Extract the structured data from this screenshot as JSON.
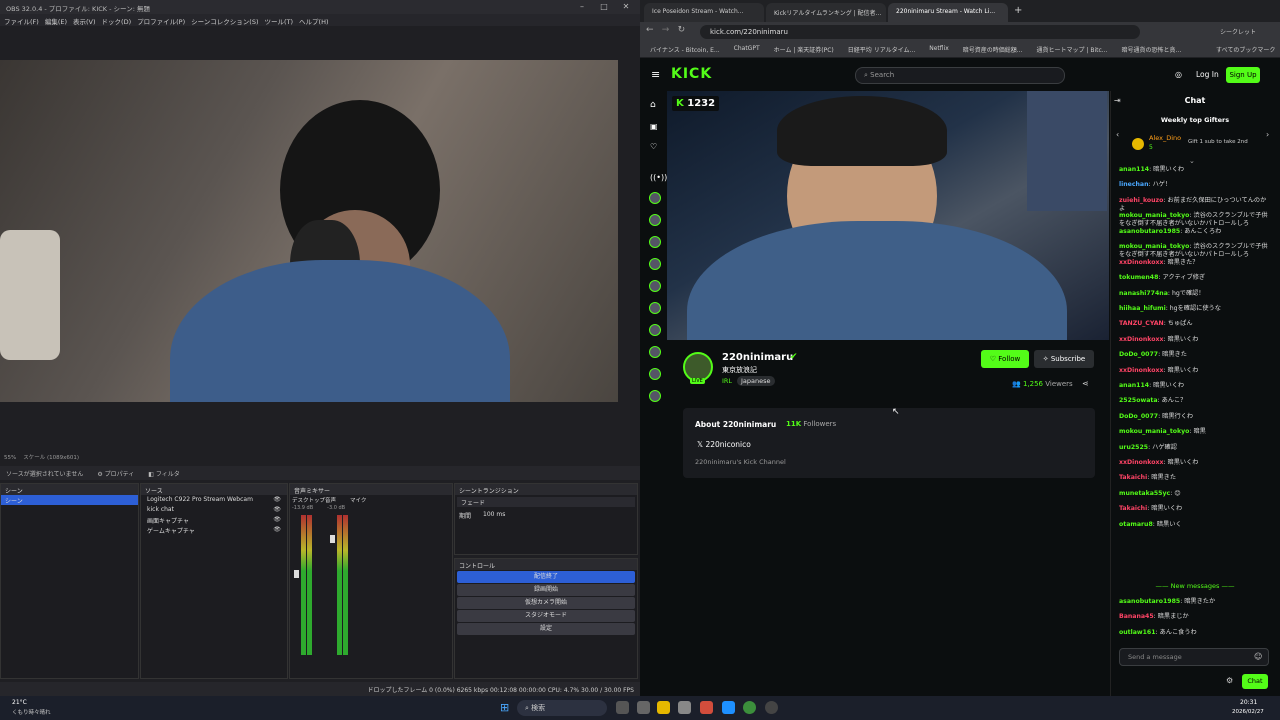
{
  "obs": {
    "title": "OBS 32.0.4 - プロファイル: KICK - シーン: 無題",
    "menu": [
      "ファイル(F)",
      "編集(E)",
      "表示(V)",
      "ドック(D)",
      "プロファイル(P)",
      "シーンコレクション(S)",
      "ツール(T)",
      "ヘルプ(H)"
    ],
    "zoom": "55%",
    "scale": "スケール (1089x601)",
    "no_source": "ソースが選択されていません",
    "properties": "プロパティ",
    "filters": "フィルタ",
    "scenes_header": "シーン",
    "scene_item": "シーン",
    "sources_header": "ソース",
    "sources": [
      "Logitech C922 Pro Stream Webcam",
      "kick chat",
      "画面キャプチャ",
      "ゲームキャプチャ"
    ],
    "mixer_header": "音声ミキサー",
    "mixer_ch1": "デスクトップ音声",
    "mixer_ch1_db": "-13.9 dB",
    "mixer_ch2": "マイク",
    "mixer_ch2_db": "-3.0 dB",
    "transition_header": "シーントランジション",
    "transition_value": "フェード",
    "duration_label": "期間",
    "duration_value": "100 ms",
    "controls_header": "コントロール",
    "controls": [
      "配信終了",
      "録画開始",
      "仮想カメラ開始",
      "スタジオモード",
      "設定"
    ],
    "status": "ドロップしたフレーム 0 (0.0%)   6265 kbps   00:12:08   00:00:00   CPU: 4.7%  30.00 / 30.00 FPS"
  },
  "browser": {
    "tabs": [
      "Ice Poseidon Stream - Watch...",
      "Kickリアルタイムランキング | 配信者...",
      "220ninimaru Stream - Watch Li..."
    ],
    "url": "kick.com/220ninimaru",
    "incognito": "シークレット",
    "bookmarks": [
      "バイナンス - Bitcoin, E...",
      "ChatGPT",
      "ホーム | 楽天証券(PC)",
      "日経平均 リアルタイム...",
      "Netflix",
      "暗号資産の時価総額...",
      "通貨ヒートマップ | Bitc...",
      "暗号通貨の恐怖と貪...",
      "すべてのブックマーク"
    ]
  },
  "kick": {
    "logo": "KICK",
    "search_placeholder": "Search",
    "login": "Log In",
    "signup": "Sign Up",
    "viewer_badge": "1232",
    "channel_name": "220ninimaru",
    "stream_title": "東京放浪記",
    "category": "IRL",
    "language": "Japanese",
    "follow": "Follow",
    "subscribe": "Subscribe",
    "viewers": "1,256",
    "viewers_label": "Viewers",
    "about_title": "About 220ninimaru",
    "followers": "11K",
    "followers_label": "Followers",
    "twitter": "220niconico",
    "about_desc": "220ninimaru's Kick Channel",
    "live_badge": "LIVE"
  },
  "chat": {
    "title": "Chat",
    "gifters_title": "Weekly top Gifters",
    "gifter_name": "Alex_Dino",
    "gifter_count": "5",
    "gifter_prompt": "Gift 1 sub to take 2nd",
    "messages": [
      {
        "user": "anan114",
        "color": "#53fc18",
        "text": "暗黒いくわ"
      },
      {
        "user": "linechan",
        "color": "#4aa8ff",
        "text": "ハゲ！"
      },
      {
        "user": "zuiehi_kouzo",
        "color": "#ff4466",
        "text": "お前まだ久保田にひっついてんのかよ"
      },
      {
        "user": "mokou_mania_tokyo",
        "color": "#53fc18",
        "text": "渋谷のスクランブルで子供をなぎ倒す不届き者がいないかパトロールしろ"
      },
      {
        "user": "asanobutaro1985",
        "color": "#53fc18",
        "text": "あんこくろわ"
      },
      {
        "user": "mokou_mania_tokyo",
        "color": "#53fc18",
        "text": "渋谷のスクランブルで子供をなぎ倒す不届き者がいないかパトロールしろ"
      },
      {
        "user": "xxDinonkoxx",
        "color": "#ff4466",
        "text": "暗黒きた？"
      },
      {
        "user": "tokumen48",
        "color": "#53fc18",
        "text": "アクティブ修ぎ"
      },
      {
        "user": "nanashi774na",
        "color": "#53fc18",
        "text": "hgで確認！"
      },
      {
        "user": "hiihaa_hifumi",
        "color": "#53fc18",
        "text": "hgを確認に使うな"
      },
      {
        "user": "TANZU_CYAN",
        "color": "#ff4466",
        "text": "ちゅぱん"
      },
      {
        "user": "xxDinonkoxx",
        "color": "#ff4466",
        "text": "暗黒いくわ"
      },
      {
        "user": "DoDo_0077",
        "color": "#53fc18",
        "text": "暗黒きた"
      },
      {
        "user": "xxDinonkoxx",
        "color": "#ff4466",
        "text": "暗黒いくわ"
      },
      {
        "user": "anan114",
        "color": "#53fc18",
        "text": "暗黒いくわ"
      },
      {
        "user": "2525owata",
        "color": "#53fc18",
        "text": "あんこ？"
      },
      {
        "user": "DoDo_0077",
        "color": "#53fc18",
        "text": "暗黒行くわ"
      },
      {
        "user": "mokou_mania_tokyo",
        "color": "#53fc18",
        "text": "暗黒"
      },
      {
        "user": "uru2525",
        "color": "#53fc18",
        "text": "ハゲ確認"
      },
      {
        "user": "xxDinonkoxx",
        "color": "#ff4466",
        "text": "暗黒いくわ"
      },
      {
        "user": "Takaichi",
        "color": "#ff4466",
        "text": "暗黒きた"
      },
      {
        "user": "munetaka55yc",
        "color": "#53fc18",
        "text": "😊"
      },
      {
        "user": "Takaichi",
        "color": "#ff4466",
        "text": "暗黒いくわ"
      },
      {
        "user": "otamaru8",
        "color": "#53fc18",
        "text": "暗黒いく"
      }
    ],
    "new_messages_label": "New messages",
    "new_messages": [
      {
        "user": "asanobutaro1985",
        "color": "#53fc18",
        "text": "暗黒きたか"
      },
      {
        "user": "Banana45",
        "color": "#ff4466",
        "text": "暗黒まじか"
      },
      {
        "user": "outlaw161",
        "color": "#53fc18",
        "text": "あんこ食うわ"
      }
    ],
    "input_placeholder": "Send a message",
    "send_label": "Chat"
  },
  "taskbar": {
    "weather_temp": "21°C",
    "weather_desc": "くもり時々晴れ",
    "search": "検索",
    "time": "20:31",
    "date": "2026/02/27"
  }
}
